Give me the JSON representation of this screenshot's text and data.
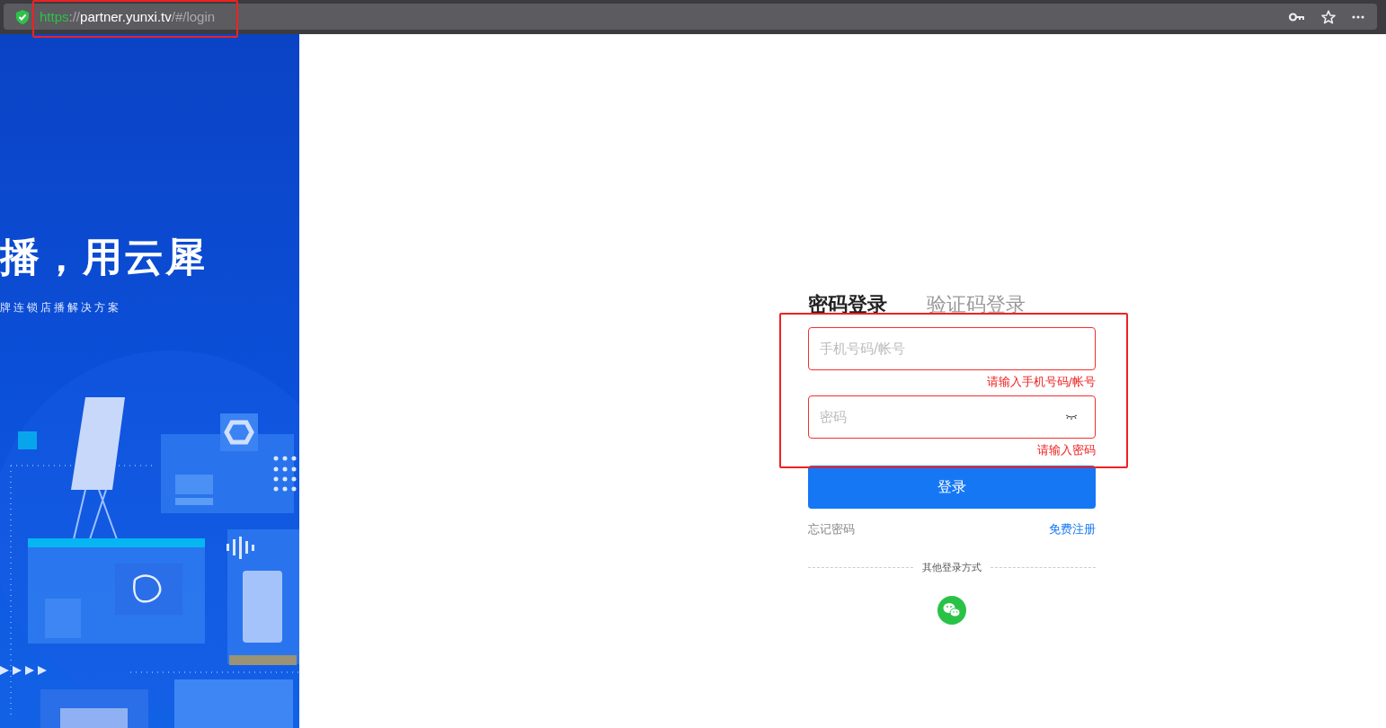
{
  "browser": {
    "address": [
      {
        "text": "https",
        "kind": "secure"
      },
      {
        "text": "://",
        "kind": "dim"
      },
      {
        "text": "partner.yunxi.tv",
        "kind": "host"
      },
      {
        "text": "/#/login",
        "kind": "dim"
      }
    ]
  },
  "banner": {
    "headline": "播，用云犀",
    "subtitle": "牌连锁店播解决方案"
  },
  "tabs": [
    {
      "label": "密码登录",
      "selected": true
    },
    {
      "label": "验证码登录",
      "selected": false
    }
  ],
  "fields": [
    {
      "kind": "account",
      "placeholder": "手机号码/帐号",
      "error": "请输入手机号码/帐号"
    },
    {
      "kind": "password",
      "placeholder": "密码",
      "error": "请输入密码"
    }
  ],
  "submit": "登录",
  "forgot": "忘记密码",
  "register": "免费注册",
  "other_login": "其他登录方式"
}
